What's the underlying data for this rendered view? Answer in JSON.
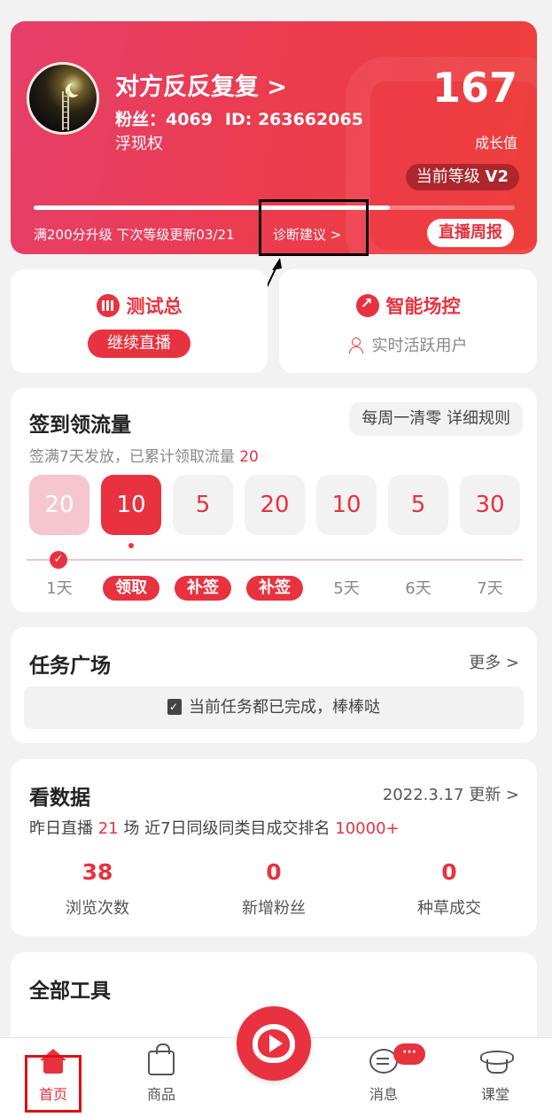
{
  "header": {
    "username": "对方反反复复 >",
    "fans_label": "粉丝：4069",
    "id_label": "ID: 263662065",
    "subname": "浮现权",
    "score": "167",
    "score_label": "成长值",
    "level_prefix": "当前等级 ",
    "level_value": "V2",
    "progress_fraction": 0.74,
    "upgrade_text": "满200分升级 下次等级更新03/21",
    "diagnose_link": "诊断建议 >",
    "weekly_report_button": "直播周报"
  },
  "cards": {
    "left": {
      "title": "测试总",
      "button": "继续直播"
    },
    "right": {
      "title": "智能场控",
      "subtitle": "实时活跃用户"
    }
  },
  "signin": {
    "title": "签到领流量",
    "rules_button": "每周一清零 详细规则",
    "desc_prefix": "签满7天发放，已累计领取流量 ",
    "desc_value": "20",
    "days": [
      {
        "value": "20",
        "state": "done",
        "label": "1天"
      },
      {
        "value": "10",
        "state": "today",
        "label": "领取"
      },
      {
        "value": "5",
        "state": "missed",
        "label": "补签"
      },
      {
        "value": "20",
        "state": "missed",
        "label": "补签"
      },
      {
        "value": "10",
        "state": "future",
        "label": "5天"
      },
      {
        "value": "5",
        "state": "future",
        "label": "6天"
      },
      {
        "value": "30",
        "state": "future",
        "label": "7天"
      }
    ]
  },
  "tasks": {
    "title": "任务广场",
    "more_link": "更多 >",
    "empty_text": "当前任务都已完成，棒棒哒"
  },
  "data": {
    "title": "看数据",
    "updated_link": "2022.3.17 更新 >",
    "desc_1": "昨日直播 ",
    "desc_num_1": "21",
    "desc_2": " 场  近7日同级同类目成交排名 ",
    "desc_num_2": "10000+",
    "stats": [
      {
        "value": "38",
        "label": "浏览次数"
      },
      {
        "value": "0",
        "label": "新增粉丝"
      },
      {
        "value": "0",
        "label": "种草成交"
      }
    ]
  },
  "tools": {
    "title": "全部工具"
  },
  "tabbar": {
    "home": "首页",
    "goods": "商品",
    "messages": "消息",
    "messages_badge": "···",
    "classroom": "课堂"
  },
  "colors": {
    "accent": "#e8323f",
    "hero_gradient_start": "#e63f6a",
    "hero_gradient_end": "#ee3e3a",
    "annotation_box": "#000000",
    "home_highlight": "#e01010"
  }
}
